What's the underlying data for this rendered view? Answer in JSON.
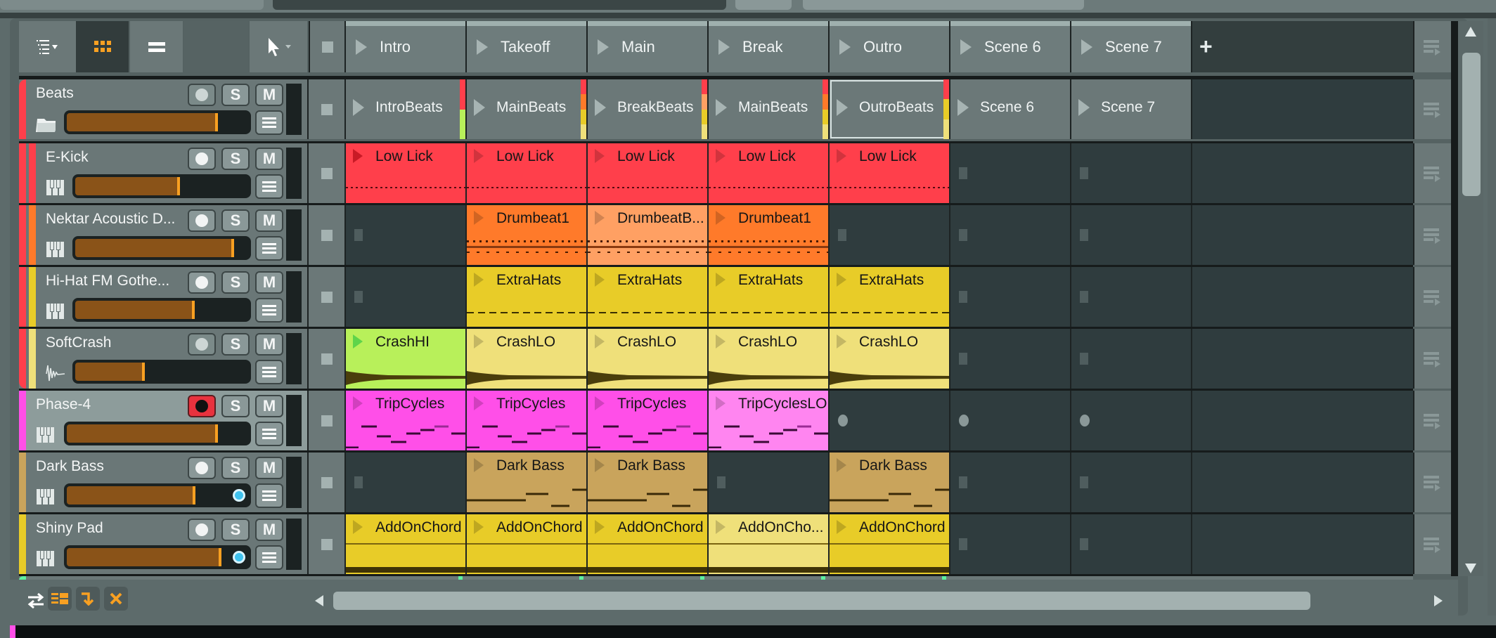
{
  "toolbar": {
    "icons": [
      "track-list-menu-icon",
      "clip-grid-view-icon",
      "single-view-icon",
      "pointer-tool-icon"
    ],
    "add_scene_label": "+"
  },
  "scenes": [
    "Intro",
    "Takeoff",
    "Main",
    "Break",
    "Outro",
    "Scene 6",
    "Scene 7"
  ],
  "tracks": [
    {
      "name": "Beats",
      "type": "group",
      "color": "#ff3f4b",
      "volume": 0.8,
      "armed": false,
      "rec_dim": true,
      "pan": false,
      "clips": [
        {
          "label": "IntroBeats",
          "kind": "group",
          "levels": [
            "#ff3f4b",
            "#b8f05a"
          ]
        },
        {
          "label": "MainBeats",
          "kind": "group",
          "levels": [
            "#ff3f4b",
            "#ff7a2a",
            "#e8cc28",
            "#efe07a"
          ]
        },
        {
          "label": "BreakBeats",
          "kind": "group",
          "levels": [
            "#ff3f4b",
            "#ffa063",
            "#e8cc28",
            "#efe07a"
          ]
        },
        {
          "label": "MainBeats",
          "kind": "group",
          "levels": [
            "#ff3f4b",
            "#ff7a2a",
            "#e8cc28",
            "#efe07a"
          ]
        },
        {
          "label": "OutroBeats",
          "kind": "group",
          "levels": [
            "#ff3f4b",
            "#e8cc28",
            "#efe07a"
          ],
          "selected": true
        },
        {
          "label": "Scene 6",
          "kind": "group"
        },
        {
          "label": "Scene 7",
          "kind": "group"
        }
      ]
    },
    {
      "name": "E-Kick",
      "type": "instrument",
      "color": "#ff3f4b",
      "volume": 0.58,
      "armed": false,
      "pan": false,
      "clips": [
        {
          "label": "Low Lick",
          "bg": "#ff3f4b",
          "play": "#cf1f2a",
          "pattern": "dots"
        },
        {
          "label": "Low Lick",
          "bg": "#ff3f4b",
          "pattern": "dots"
        },
        {
          "label": "Low Lick",
          "bg": "#ff3f4b",
          "pattern": "dots"
        },
        {
          "label": "Low Lick",
          "bg": "#ff3f4b",
          "pattern": "dots"
        },
        {
          "label": "Low Lick",
          "bg": "#ff3f4b",
          "pattern": "dots"
        },
        null,
        null
      ]
    },
    {
      "name": "Nektar Acoustic D...",
      "type": "instrument",
      "color": "#ff7a2a",
      "volume": 0.88,
      "armed": false,
      "pan": false,
      "clips": [
        null,
        {
          "label": "Drumbeat1",
          "bg": "#ff7a2a",
          "pattern": "drums"
        },
        {
          "label": "DrumbeatB...",
          "bg": "#ffa063",
          "pattern": "drums"
        },
        {
          "label": "Drumbeat1",
          "bg": "#ff7a2a",
          "pattern": "drums"
        },
        null,
        null,
        null
      ]
    },
    {
      "name": "Hi-Hat FM Gothe...",
      "type": "instrument",
      "color": "#e8cc28",
      "volume": 0.66,
      "armed": false,
      "pan": false,
      "clips": [
        null,
        {
          "label": "ExtraHats",
          "bg": "#e8cc28",
          "pattern": "dashes"
        },
        {
          "label": "ExtraHats",
          "bg": "#e8cc28",
          "pattern": "dashes"
        },
        {
          "label": "ExtraHats",
          "bg": "#e8cc28",
          "pattern": "dashes"
        },
        {
          "label": "ExtraHats",
          "bg": "#e8cc28",
          "pattern": "dashes"
        },
        null,
        null
      ]
    },
    {
      "name": "SoftCrash",
      "type": "audio",
      "color": "#efe07a",
      "volume": 0.38,
      "armed": false,
      "rec_dim": true,
      "pan": false,
      "clips": [
        {
          "label": "CrashHI",
          "bg": "#b8f05a",
          "pattern": "wave",
          "playing": true
        },
        {
          "label": "CrashLO",
          "bg": "#efe07a",
          "pattern": "wave"
        },
        {
          "label": "CrashLO",
          "bg": "#efe07a",
          "pattern": "wave"
        },
        {
          "label": "CrashLO",
          "bg": "#efe07a",
          "pattern": "wave"
        },
        {
          "label": "CrashLO",
          "bg": "#efe07a",
          "pattern": "wave"
        },
        null,
        null
      ]
    },
    {
      "name": "Phase-4",
      "type": "instrument",
      "color": "#ff4fe8",
      "volume": 0.8,
      "armed": true,
      "pan": false,
      "topLevel": true,
      "clips": [
        {
          "label": "TripCycles",
          "bg": "#ff4fe8",
          "pattern": "notes"
        },
        {
          "label": "TripCycles",
          "bg": "#ff4fe8",
          "pattern": "notes"
        },
        {
          "label": "TripCycles",
          "bg": "#ff4fe8",
          "pattern": "notes"
        },
        {
          "label": "TripCyclesLO",
          "bg": "#ff85f0",
          "pattern": "notes"
        },
        "rec",
        "rec",
        "rec"
      ]
    },
    {
      "name": "Dark Bass",
      "type": "instrument",
      "color": "#c9a45c",
      "volume": 0.68,
      "armed": false,
      "pan": true,
      "topLevel": true,
      "clips": [
        null,
        {
          "label": "Dark Bass",
          "bg": "#c9a45c",
          "pattern": "bass"
        },
        {
          "label": "Dark Bass",
          "bg": "#c9a45c",
          "pattern": "bass"
        },
        null,
        {
          "label": "Dark Bass",
          "bg": "#c9a45c",
          "pattern": "bass"
        },
        null,
        null
      ]
    },
    {
      "name": "Shiny Pad",
      "type": "instrument",
      "color": "#e8cc28",
      "volume": 0.82,
      "armed": false,
      "pan": true,
      "topLevel": true,
      "clips": [
        {
          "label": "AddOnChord",
          "bg": "#e8cc28",
          "pattern": "pad"
        },
        {
          "label": "AddOnChord",
          "bg": "#e8cc28",
          "pattern": "pad"
        },
        {
          "label": "AddOnChord",
          "bg": "#e8cc28",
          "pattern": "pad"
        },
        {
          "label": "AddOnCho...",
          "bg": "#efe07a",
          "pattern": "pad"
        },
        {
          "label": "AddOnChord",
          "bg": "#e8cc28",
          "pattern": "pad"
        },
        null,
        null
      ]
    }
  ],
  "bottom_toolbar": {
    "icons": [
      "swap-arrows-icon",
      "clip-launcher-layout-icon",
      "arrow-down-right-icon",
      "close-x-icon"
    ]
  },
  "colors": {
    "accent": "#f8a022",
    "fader_fill": "#8a5318",
    "record": "#e8323e",
    "pan": "#3fc2ee",
    "playing": "#5ef0a0"
  }
}
